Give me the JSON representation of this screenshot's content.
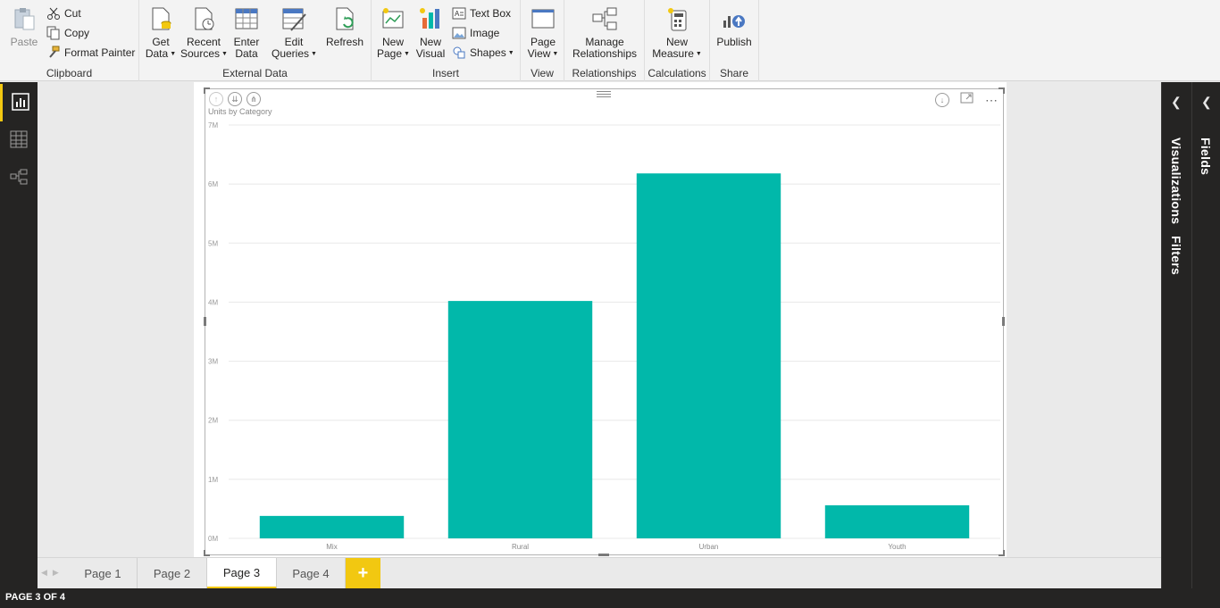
{
  "ribbon": {
    "clipboard": {
      "label": "Clipboard",
      "paste": "Paste",
      "cut": "Cut",
      "copy": "Copy",
      "format_painter": "Format Painter"
    },
    "external_data": {
      "label": "External Data",
      "get_data": [
        "Get",
        "Data"
      ],
      "recent_sources": [
        "Recent",
        "Sources"
      ],
      "enter_data": [
        "Enter",
        "Data"
      ],
      "edit_queries": [
        "Edit",
        "Queries"
      ],
      "refresh": "Refresh"
    },
    "insert": {
      "label": "Insert",
      "new_page": [
        "New",
        "Page"
      ],
      "new_visual": [
        "New",
        "Visual"
      ],
      "text_box": "Text Box",
      "image": "Image",
      "shapes": "Shapes"
    },
    "view": {
      "label": "View",
      "page_view": [
        "Page",
        "View"
      ]
    },
    "relationships": {
      "label": "Relationships",
      "manage": [
        "Manage",
        "Relationships"
      ]
    },
    "calculations": {
      "label": "Calculations",
      "new_measure": [
        "New",
        "Measure"
      ]
    },
    "share": {
      "label": "Share",
      "publish": "Publish"
    }
  },
  "left_nav": {
    "items": [
      {
        "icon": "report-view-icon",
        "active": true
      },
      {
        "icon": "data-view-icon",
        "active": false
      },
      {
        "icon": "relationships-view-icon",
        "active": false
      }
    ]
  },
  "panes": {
    "visualizations": "Visualizations",
    "filters": "Filters",
    "fields": "Fields"
  },
  "visual": {
    "title": "Units by Category"
  },
  "chart_data": {
    "type": "bar",
    "title": "Units by Category",
    "categories": [
      "Mix",
      "Rural",
      "Urban",
      "Youth"
    ],
    "values": [
      380000,
      4020000,
      6180000,
      560000
    ],
    "ylim": [
      0,
      7000000
    ],
    "yticks": [
      0,
      1000000,
      2000000,
      3000000,
      4000000,
      5000000,
      6000000,
      7000000
    ],
    "ytick_labels": [
      "0M",
      "1M",
      "2M",
      "3M",
      "4M",
      "5M",
      "6M",
      "7M"
    ],
    "grid": true,
    "bar_color": "#01b8aa",
    "xlabel": "",
    "ylabel": ""
  },
  "tabs": {
    "pages": [
      "Page 1",
      "Page 2",
      "Page 3",
      "Page 4"
    ],
    "active_index": 2,
    "add_label": "+"
  },
  "status": {
    "text": "PAGE 3 OF 4"
  },
  "colors": {
    "accent": "#f2c811",
    "dark": "#252423",
    "bar": "#01b8aa"
  }
}
